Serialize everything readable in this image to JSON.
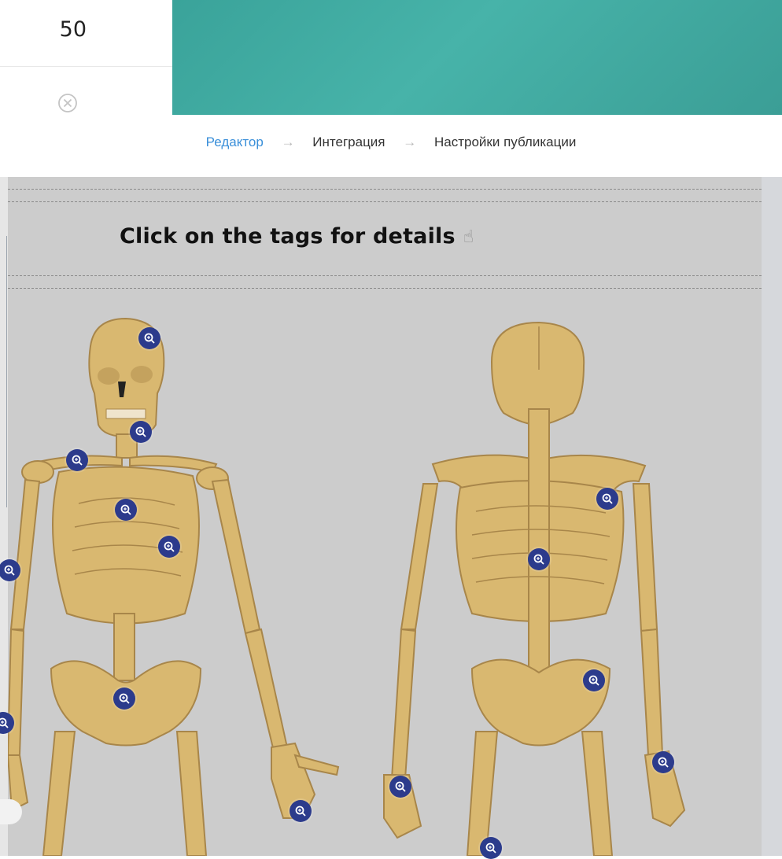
{
  "top_panel": {
    "value": "50",
    "clear_icon": "close-circle-icon"
  },
  "breadcrumb": {
    "steps": [
      "Редактор",
      "Интеграция",
      "Настройки публикации"
    ],
    "separator": "→",
    "active_index": 0
  },
  "stage": {
    "headline": "Click on the tags for details",
    "headline_icon": "pointing-hand-icon",
    "tag_icon": "magnify-plus-icon",
    "tag_color": "#2c3b8c"
  },
  "colors": {
    "banner": "#44aea4",
    "stage_background": "#cccccc",
    "bone": "#d9b870",
    "active_step": "#3a8fd9"
  }
}
